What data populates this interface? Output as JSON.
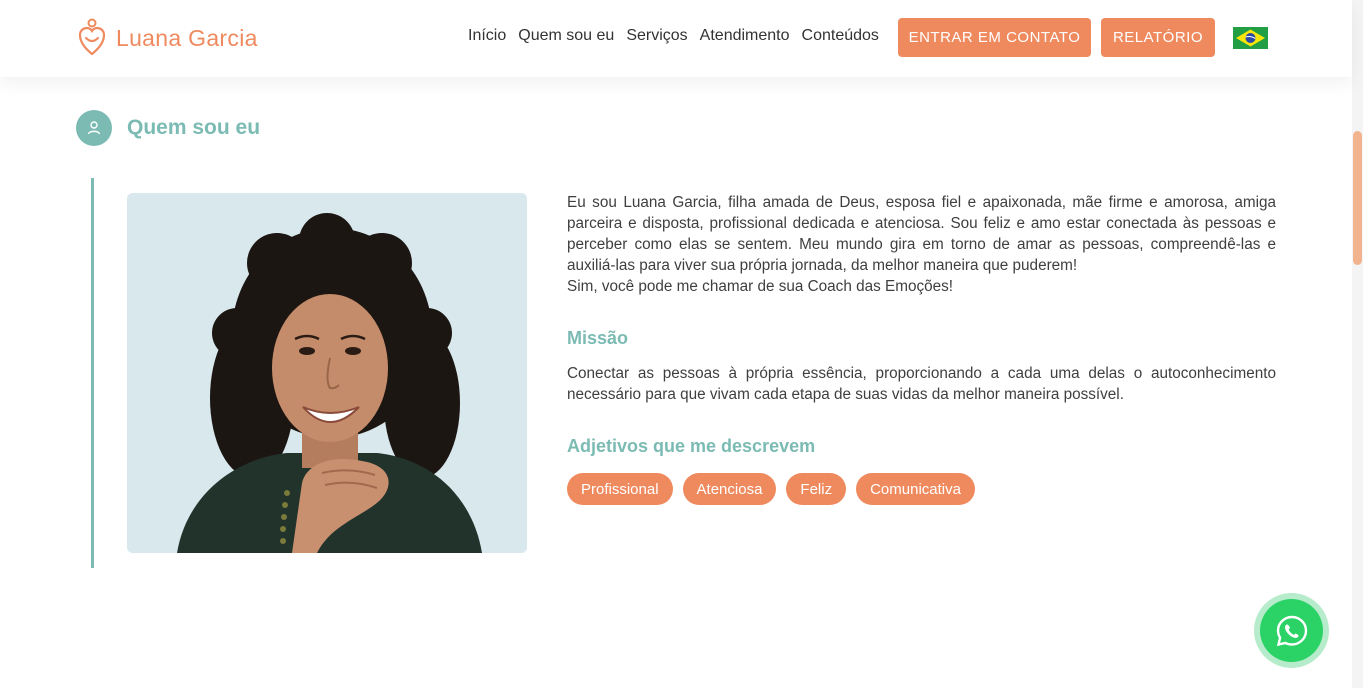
{
  "header": {
    "logo_text": "Luana Garcia",
    "logo_icon": "heart-person-icon",
    "nav": [
      {
        "label": "Início"
      },
      {
        "label": "Quem sou eu"
      },
      {
        "label": "Serviços"
      },
      {
        "label": "Atendimento"
      },
      {
        "label": "Conteúdos"
      }
    ],
    "contact_button": "ENTRAR EM CONTATO",
    "report_button": "RELATÓRIO",
    "flag_icon": "brazil-flag-icon"
  },
  "section": {
    "icon": "user-icon",
    "title": "Quem sou eu"
  },
  "profile": {
    "photo_alt": "Luana Garcia",
    "bio_line1": "Eu sou Luana Garcia, filha amada de Deus, esposa fiel e apaixonada, mãe firme e amorosa, amiga parceira e disposta, profissional dedicada e atenciosa. Sou feliz e amo estar conectada às pessoas e perceber como elas se sentem. Meu mundo gira em torno de amar as pessoas, compreendê-las e auxiliá-las para viver sua própria jornada, da melhor maneira que puderem!",
    "bio_line2": "Sim, você pode me chamar de sua Coach das Emoções!",
    "mission_title": "Missão",
    "mission_text": "Conectar as pessoas à própria essência, proporcionando a cada uma delas o autoconhecimento necessário para que vivam cada etapa de suas vidas da melhor maneira possível.",
    "adjectives_title": "Adjetivos que me descrevem",
    "adjectives": [
      "Profissional",
      "Atenciosa",
      "Feliz",
      "Comunicativa"
    ]
  },
  "whatsapp": {
    "icon": "whatsapp-icon"
  },
  "colors": {
    "accent": "#ef8a5f",
    "teal": "#7bbbb3",
    "whatsapp": "#2bd366"
  }
}
